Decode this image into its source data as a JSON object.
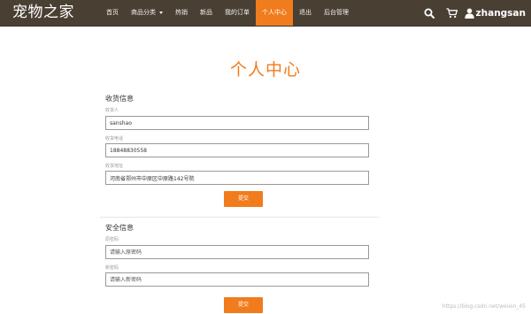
{
  "navbar": {
    "brand": "宠物之家",
    "items": [
      {
        "label": "首页",
        "active": false
      },
      {
        "label": "商品分类",
        "active": false,
        "dropdown": true
      },
      {
        "label": "热销",
        "active": false
      },
      {
        "label": "新品",
        "active": false
      },
      {
        "label": "我的订单",
        "active": false
      },
      {
        "label": "个人中心",
        "active": true
      },
      {
        "label": "退出",
        "active": false
      },
      {
        "label": "后台管理",
        "active": false
      }
    ],
    "username": "zhangsan",
    "icons": [
      "search-icon",
      "cart-icon",
      "user-icon"
    ],
    "background_color": "#4a3f33",
    "active_color": "#f07c1d"
  },
  "page": {
    "title": "个人中心",
    "accent_color": "#f07c1d"
  },
  "shipping": {
    "section_title": "收货信息",
    "receiver_label": "收货人",
    "receiver_value": "sanshao",
    "phone_label": "收货电话",
    "phone_value": "18848830558",
    "address_label": "收货地址",
    "address_value": "河南省郑州市中原区中原路142号院",
    "submit_label": "提交"
  },
  "security": {
    "section_title": "安全信息",
    "old_password_label": "原密码",
    "old_password_placeholder": "请输入原密码",
    "new_password_label": "新密码",
    "new_password_placeholder": "请输入新密码",
    "submit_label": "提交"
  },
  "watermark": "https://blog.csdn.net/weixin_45"
}
